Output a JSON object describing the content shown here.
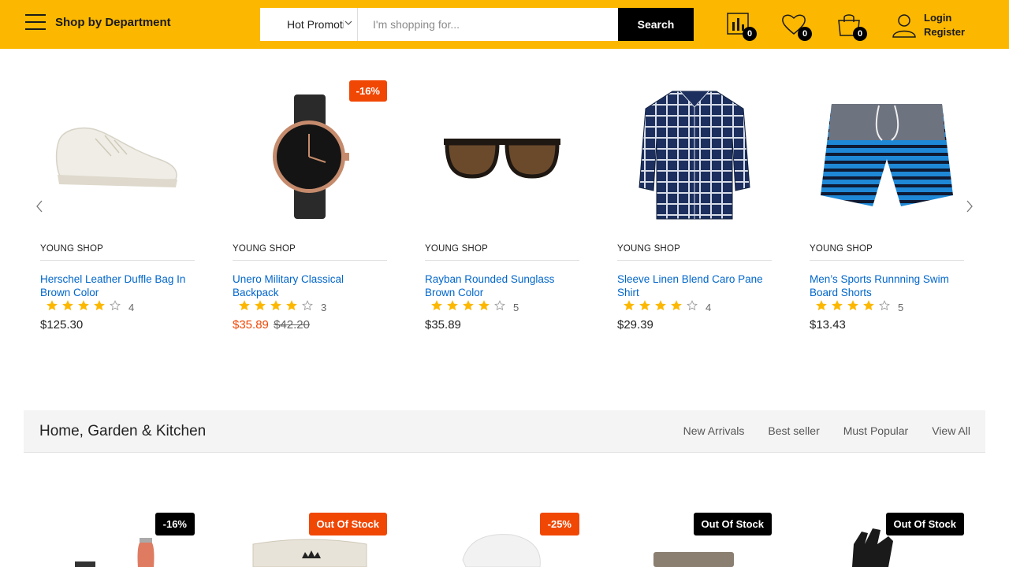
{
  "header": {
    "department_label": "Shop by Department",
    "category_value": "Hot Promotions",
    "search_placeholder": "I'm shopping for...",
    "search_button": "Search",
    "compare_count": "0",
    "wishlist_count": "0",
    "cart_count": "0",
    "login_label": "Login",
    "register_label": "Register"
  },
  "products": [
    {
      "vendor": "YOUNG SHOP",
      "name": "Herschel Leather Duffle Bag In Brown Color",
      "rating": 4,
      "rating_count": "4",
      "price": "$125.30",
      "old_price": "",
      "discount": ""
    },
    {
      "vendor": "YOUNG SHOP",
      "name": "Unero Military Classical Backpack",
      "rating": 4,
      "rating_count": "3",
      "price": "$35.89",
      "old_price": "$42.20",
      "discount": "-16%"
    },
    {
      "vendor": "YOUNG SHOP",
      "name": "Rayban Rounded Sunglass Brown Color",
      "rating": 4,
      "rating_count": "5",
      "price": "$35.89",
      "old_price": "",
      "discount": ""
    },
    {
      "vendor": "YOUNG SHOP",
      "name": "Sleeve Linen Blend Caro Pane Shirt",
      "rating": 4,
      "rating_count": "4",
      "price": "$29.39",
      "old_price": "",
      "discount": ""
    },
    {
      "vendor": "YOUNG SHOP",
      "name": "Men’s Sports Runnning Swim Board Shorts",
      "rating": 4,
      "rating_count": "5",
      "price": "$13.43",
      "old_price": "",
      "discount": ""
    }
  ],
  "section": {
    "title": "Home, Garden & Kitchen",
    "links": [
      "New Arrivals",
      "Best seller",
      "Must Popular",
      "View All"
    ]
  },
  "bottom_tags": [
    "-16%",
    "Out Of Stock",
    "-25%",
    "Out Of Stock",
    "Out Of Stock"
  ],
  "colors": {
    "brand": "#fcb800",
    "sale": "#f14705",
    "link": "#0066cc",
    "star": "#fcb800"
  }
}
